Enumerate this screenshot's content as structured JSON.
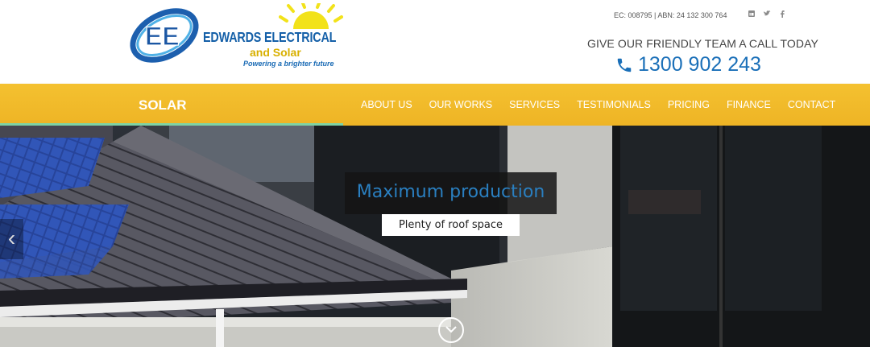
{
  "brand": {
    "logo_mark": "EE",
    "name": "EDWARDS ELECTRICAL",
    "sub": "and Solar",
    "tagline": "Powering a brighter future"
  },
  "header": {
    "registration": "EC: 008795 | ABN: 24 132 300 764",
    "social_icons": [
      "linkedin-icon",
      "twitter-icon",
      "facebook-icon"
    ],
    "cta_text": "GIVE OUR FRIENDLY TEAM A CALL TODAY",
    "phone": "1300 902 243"
  },
  "nav": {
    "title": "SOLAR",
    "items": [
      "ABOUT US",
      "OUR WORKS",
      "SERVICES",
      "TESTIMONIALS",
      "PRICING",
      "FINANCE",
      "CONTACT"
    ]
  },
  "slider": {
    "caption_title": "Maximum production",
    "caption_sub": "Plenty of roof space",
    "prev_glyph": "‹"
  },
  "colors": {
    "brand_blue": "#1a6fb8",
    "nav_yellow": "#f2bc2c",
    "progress_green": "#7ed3a4"
  }
}
